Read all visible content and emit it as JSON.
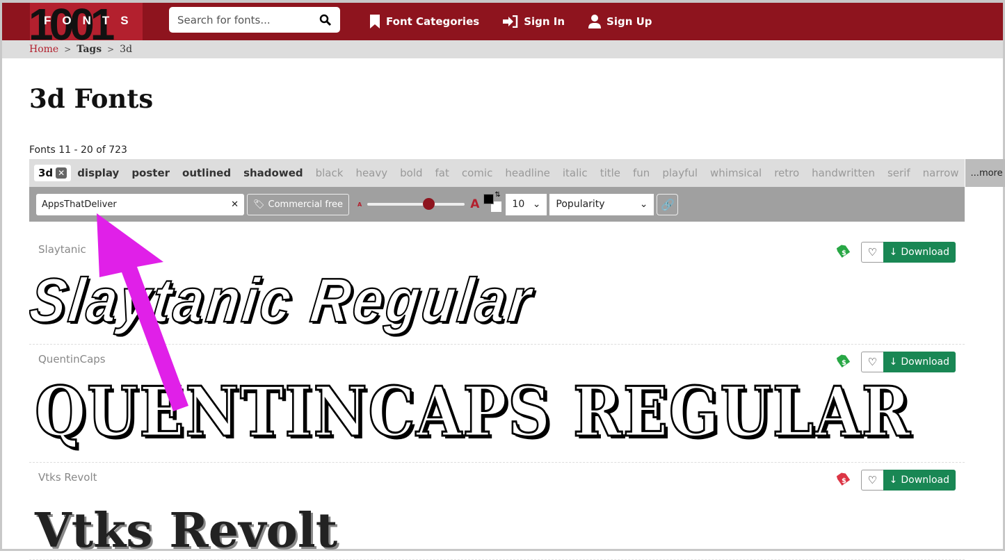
{
  "header": {
    "logo_digits": "1001",
    "logo_word": "FONTS",
    "search_placeholder": "Search for fonts...",
    "nav": [
      {
        "label": "Font Categories",
        "icon": "bookmark-icon"
      },
      {
        "label": "Sign In",
        "icon": "sign-in-icon"
      },
      {
        "label": "Sign Up",
        "icon": "user-icon"
      }
    ]
  },
  "breadcrumb": {
    "home": "Home",
    "sep": ">",
    "tags": "Tags",
    "current": "3d"
  },
  "page": {
    "title": "3d Fonts",
    "count": "Fonts 11 - 20 of 723"
  },
  "tags": {
    "selected": "3d",
    "main": [
      "display",
      "poster",
      "outlined",
      "shadowed"
    ],
    "other": [
      "black",
      "heavy",
      "bold",
      "fat",
      "comic",
      "headline",
      "italic",
      "title",
      "fun",
      "playful",
      "whimsical",
      "retro",
      "handwritten",
      "serif",
      "narrow"
    ],
    "more": "...more"
  },
  "toolbar": {
    "preview_text": "AppsThatDeliver",
    "commercial_free": "Commercial free",
    "size_percent": 65,
    "count": "10",
    "sort": "Popularity",
    "fg_color": "#000000",
    "bg_color": "#ffffff"
  },
  "fonts": [
    {
      "name": "Slaytanic",
      "preview": "Slaytanic Regular",
      "tag_color": "#28a745",
      "download": "Download"
    },
    {
      "name": "QuentinCaps",
      "preview": "QUENTINCAPS REGULAR",
      "tag_color": "#28a745",
      "download": "Download"
    },
    {
      "name": "Vtks Revolt",
      "preview": "Vtks Revolt",
      "tag_color": "#dc3545",
      "download": "Download"
    }
  ],
  "colors": {
    "header": "#8e141e",
    "accent": "#b3202e",
    "download": "#198754",
    "annotation_arrow": "#e020e8"
  }
}
